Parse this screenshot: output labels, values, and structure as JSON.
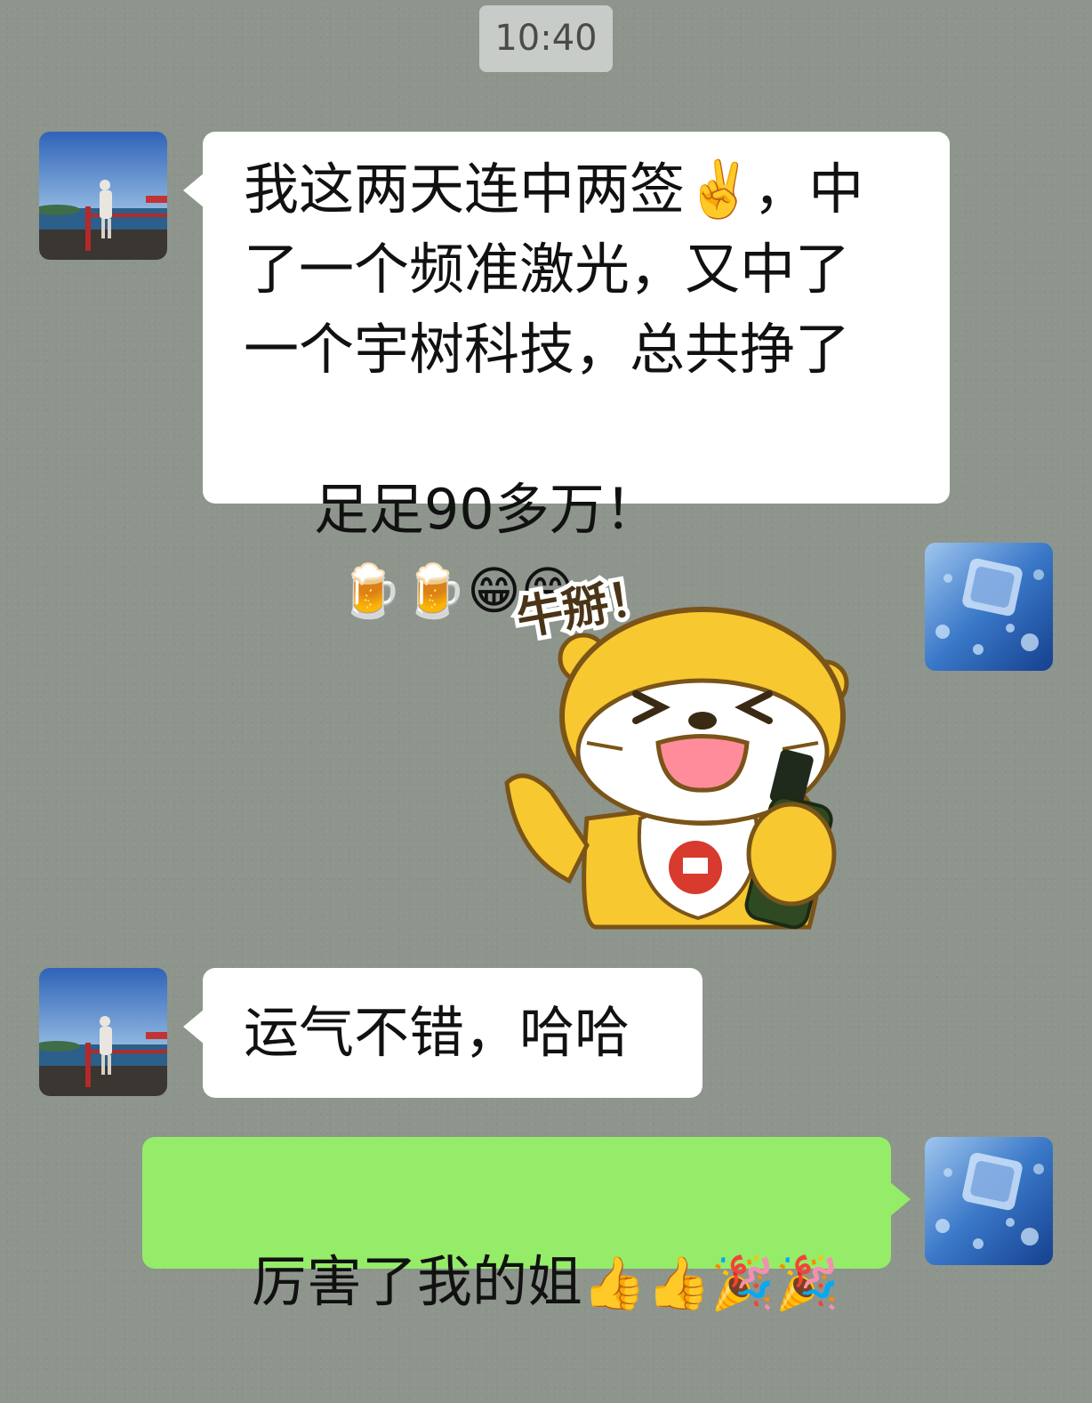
{
  "timestamp": "10:40",
  "messages": [
    {
      "sender": "other",
      "line1": "我这两天连中两签✌️，中",
      "line2": "了一个频准激光，又中了",
      "line3": "一个宇树科技，总共挣了",
      "line4": "足足90多万！",
      "emojis": "🍺🍺😁😁"
    },
    {
      "sender": "self",
      "type": "sticker",
      "sticker_text": "牛掰！"
    },
    {
      "sender": "other",
      "text": "运气不错，哈哈"
    },
    {
      "sender": "self",
      "text": "厉害了我的姐",
      "emojis": "👍👍🎉🎉"
    }
  ],
  "colors": {
    "background": "#8d958d",
    "incoming_bubble": "#ffffff",
    "outgoing_bubble": "#95ec69"
  }
}
